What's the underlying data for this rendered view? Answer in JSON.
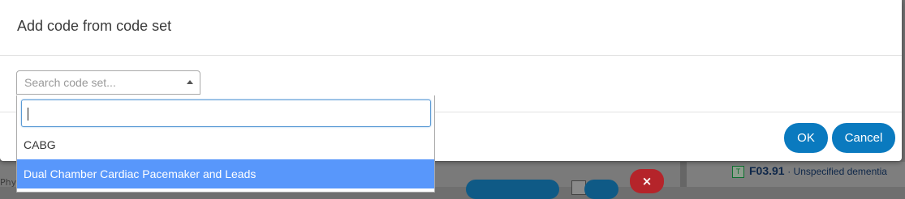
{
  "modal": {
    "title": "Add code from code set",
    "select": {
      "placeholder": "Search code set..."
    },
    "dropdown": {
      "search_value": "",
      "options": [
        {
          "label": "CABG",
          "highlighted": false
        },
        {
          "label": "Dual Chamber Cardiac Pacemaker and Leads",
          "highlighted": true
        }
      ]
    },
    "buttons": {
      "ok": "OK",
      "cancel": "Cancel"
    }
  },
  "background": {
    "left_text": "Phy",
    "delete_glyph": "×",
    "code_row": {
      "badge": "T",
      "code": "F03.91",
      "description": "· Unspecified dementia"
    }
  },
  "colors": {
    "primary_button": "#0a7abf",
    "highlight": "#5897fb",
    "focus_border": "#5b9bd5"
  }
}
